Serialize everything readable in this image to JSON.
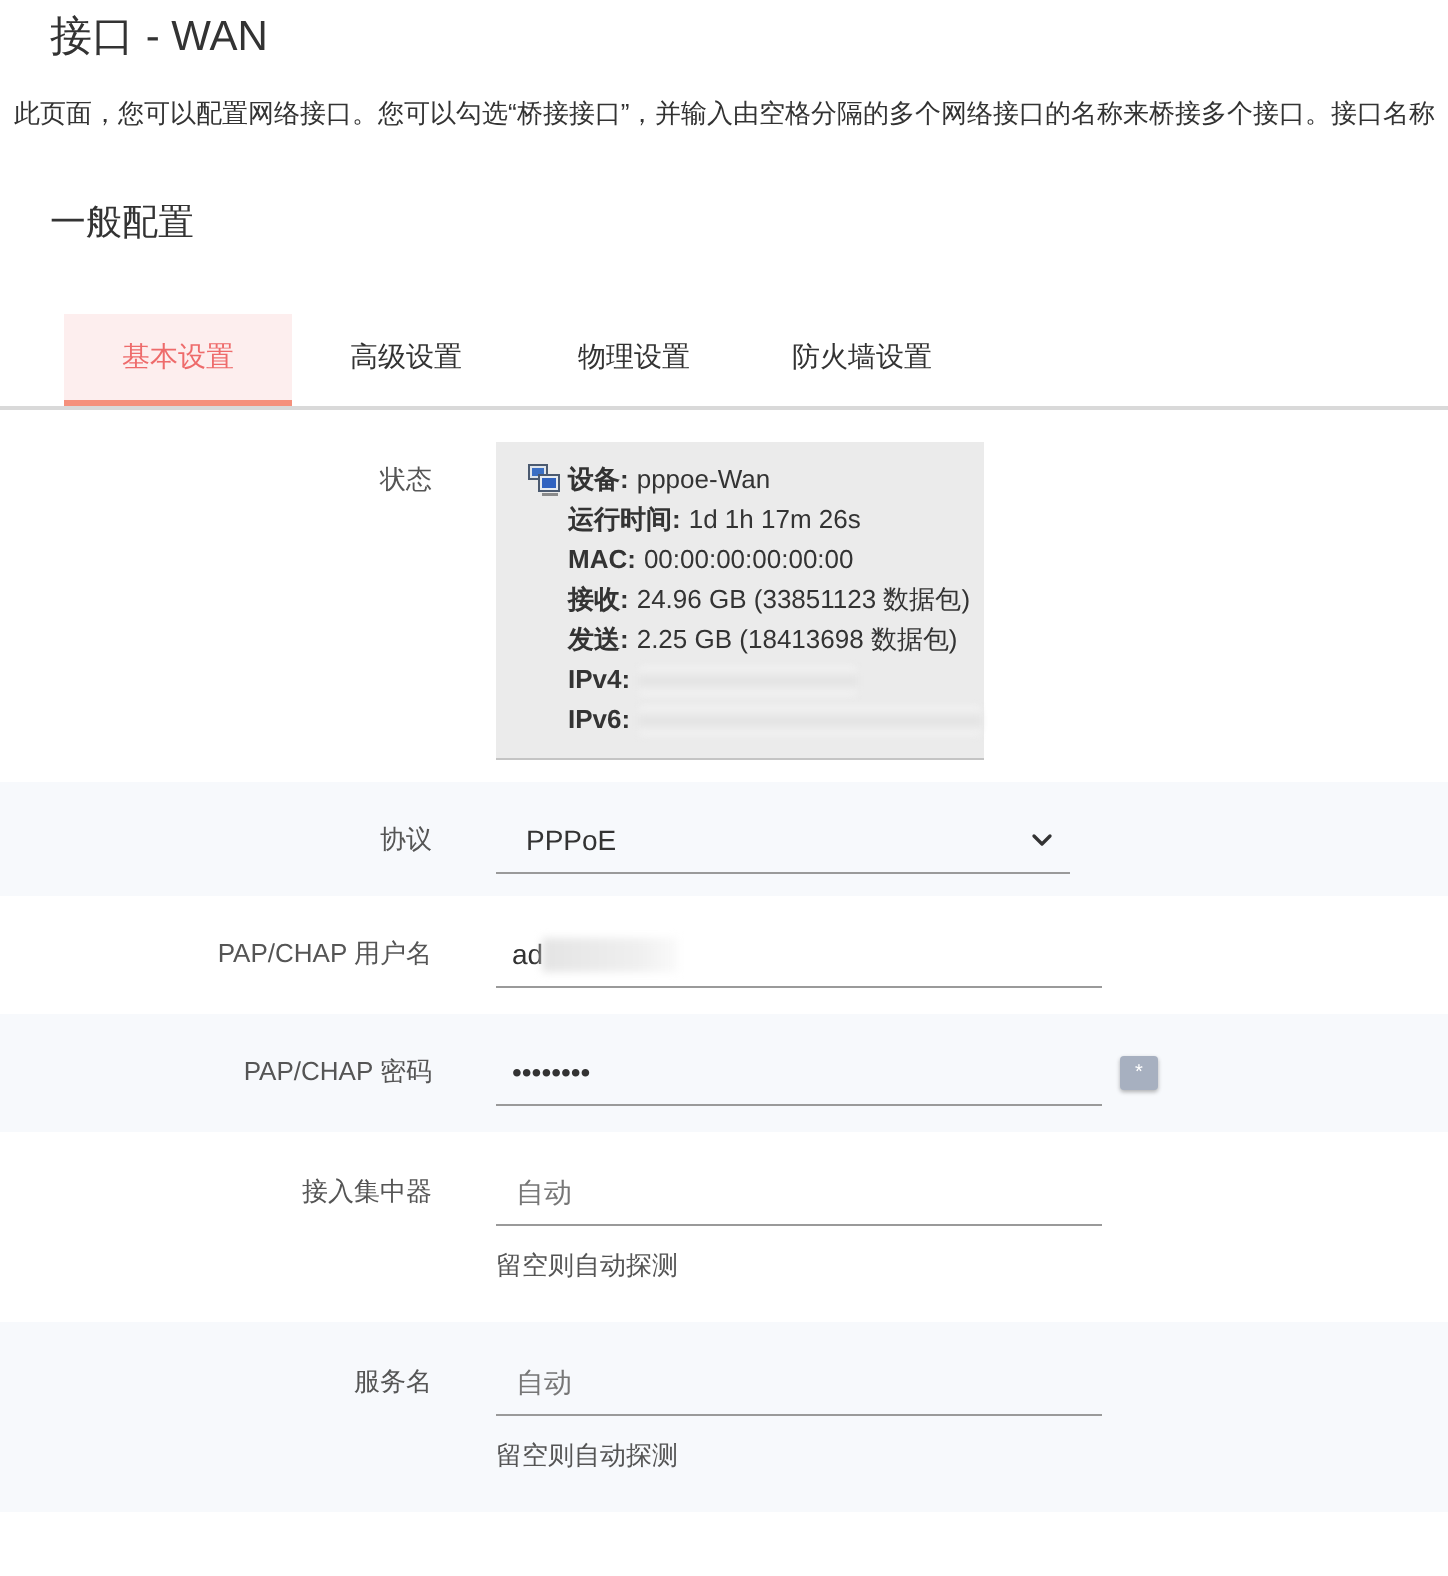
{
  "page": {
    "title": "接口 - WAN",
    "intro": "此页面，您可以配置网络接口。您可以勾选“桥接接口”，并输入由空格分隔的多个网络接口的名称来桥接多个接口。接口名称"
  },
  "section": {
    "title": "一般配置"
  },
  "tabs": [
    {
      "label": "基本设置",
      "selected": true
    },
    {
      "label": "高级设置",
      "selected": false
    },
    {
      "label": "物理设置",
      "selected": false
    },
    {
      "label": "防火墙设置",
      "selected": false
    }
  ],
  "form": {
    "rows": [
      {
        "kind": "status",
        "label": "状态",
        "lines": [
          {
            "label": "设备:",
            "value": "pppoe-Wan",
            "redacted": false
          },
          {
            "label": "运行时间:",
            "value": "1d 1h 17m 26s",
            "redacted": false
          },
          {
            "label": "MAC:",
            "value": "00:00:00:00:00:00",
            "redacted": false
          },
          {
            "label": "接收:",
            "value": "24.96 GB (33851123 数据包)",
            "redacted": false
          },
          {
            "label": "发送:",
            "value": "2.25 GB (18413698 数据包)",
            "redacted": false
          },
          {
            "label": "IPv4:",
            "redacted": true
          },
          {
            "label": "IPv6:",
            "redacted": true
          }
        ]
      },
      {
        "kind": "select",
        "label": "协议",
        "value": "PPPoE"
      },
      {
        "kind": "text",
        "label": "PAP/CHAP 用户名",
        "value": "ad",
        "redacted": true
      },
      {
        "kind": "password",
        "label": "PAP/CHAP 密码",
        "value": "••••••••",
        "reveal_button": "*"
      },
      {
        "kind": "text",
        "label": "接入集中器",
        "placeholder": "自动",
        "help": "留空则自动探测"
      },
      {
        "kind": "text",
        "label": "服务名",
        "placeholder": "自动",
        "help": "留空则自动探测"
      }
    ]
  }
}
